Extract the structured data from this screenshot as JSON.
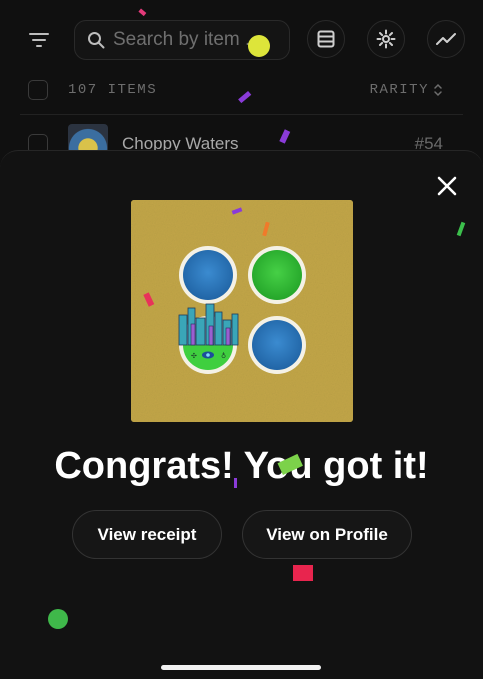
{
  "search": {
    "placeholder": "Search by item ..."
  },
  "toolbar": {
    "filter_icon": "filter-icon",
    "list_icon": "list-view-icon",
    "settings_icon": "gear-icon",
    "activity_icon": "trend-line-icon"
  },
  "list": {
    "count_label": "107 ITEMS",
    "sort_label": "RARITY",
    "rows": [
      {
        "name": "Choppy Waters",
        "number": "#54"
      }
    ]
  },
  "modal": {
    "heading": "Congrats! You got it!",
    "view_receipt_label": "View receipt",
    "view_profile_label": "View on Profile",
    "close_icon": "close-icon"
  },
  "colors": {
    "background": "#101010",
    "sheet": "#121212",
    "art_background": "#b79a3c",
    "blue_disc": "#2f7fc4",
    "green_disc": "#38c13a"
  }
}
